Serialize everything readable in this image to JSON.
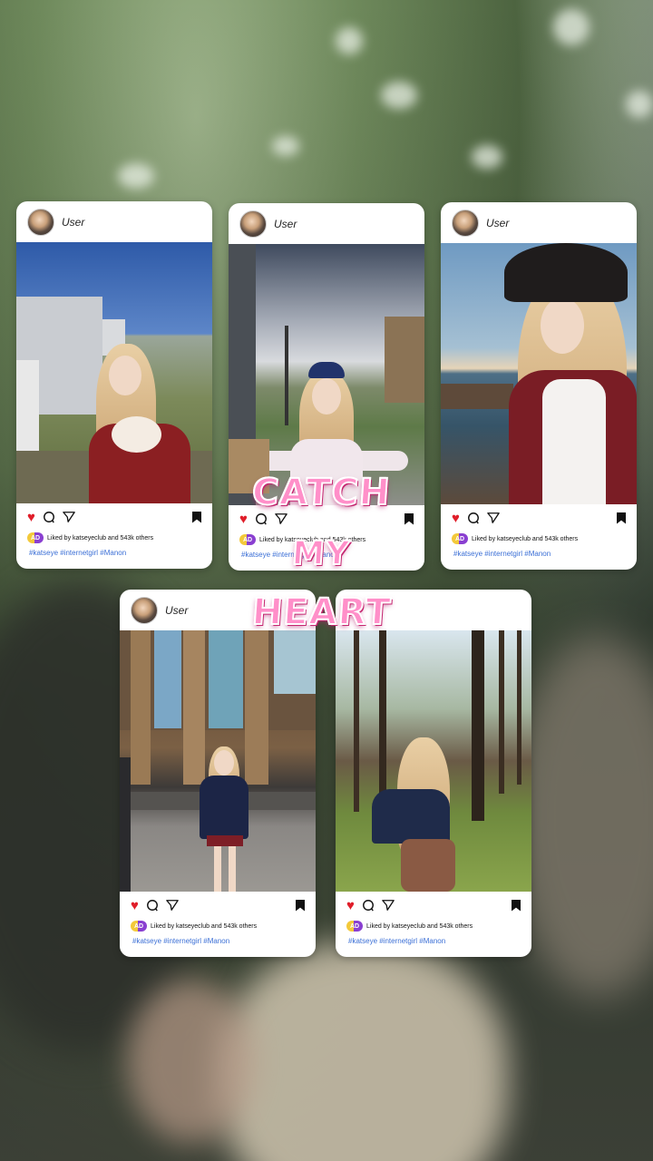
{
  "posts": [
    {
      "username": "User",
      "liked_by": "Liked by katseyeclub and 543k others",
      "liked_avatar_label": "AD",
      "tags": "#katseye #internetgirl #Manon"
    },
    {
      "username": "User",
      "liked_by": "Liked by katseyeclub and 543k others",
      "liked_avatar_label": "AD",
      "tags": "#katseye #internetgirl #Manon"
    },
    {
      "username": "User",
      "liked_by": "Liked by katseyeclub and 543k others",
      "liked_avatar_label": "AD",
      "tags": "#katseye #internetgirl #Manon"
    },
    {
      "username": "User",
      "liked_by": "Liked by katseyeclub and 543k others",
      "liked_avatar_label": "AD",
      "tags": "#katseye #internetgirl #Manon"
    },
    {
      "username": "",
      "liked_by": "Liked by katseyeclub and 543k others",
      "liked_avatar_label": "AD",
      "tags": "#katseye #internetgirl #Manon"
    }
  ],
  "overlay_title": {
    "word1": "CATCH",
    "word2": "MY",
    "word3": "HEART"
  },
  "colors": {
    "heart": "#e01e2a",
    "hashtag": "#3b6fd6",
    "title_fill": "#ff8fc9",
    "title_shadow": "#c4256f"
  },
  "icons": [
    "heart-icon",
    "comment-icon",
    "share-icon",
    "bookmark-icon"
  ]
}
